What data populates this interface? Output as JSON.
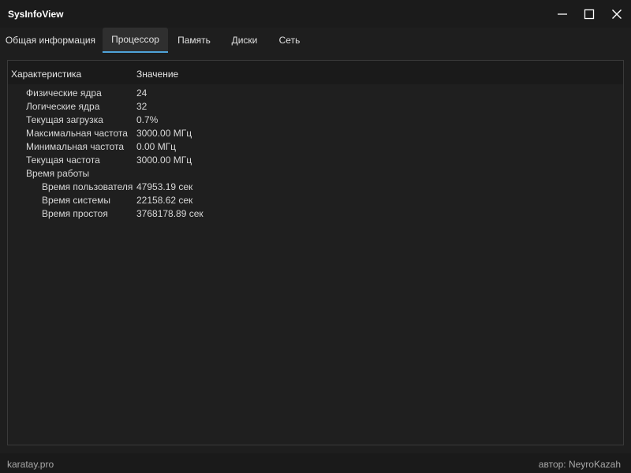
{
  "window": {
    "title": "SysInfoView",
    "controls": {
      "minimize_icon": "minimize-icon",
      "maximize_icon": "maximize-icon",
      "close_icon": "close-icon"
    }
  },
  "tabs": [
    {
      "label": "Общая информация",
      "active": false
    },
    {
      "label": "Процессор",
      "active": true
    },
    {
      "label": "Память",
      "active": false
    },
    {
      "label": "Диски",
      "active": false
    },
    {
      "label": "Сеть",
      "active": false
    }
  ],
  "tree": {
    "columns": {
      "key": "Характеристика",
      "value": "Значение"
    },
    "rows": [
      {
        "key": "Физические ядра",
        "value": "24"
      },
      {
        "key": "Логические ядра",
        "value": "32"
      },
      {
        "key": "Текущая загрузка",
        "value": "0.7%"
      },
      {
        "key": "Максимальная частота",
        "value": "3000.00 МГц"
      },
      {
        "key": "Минимальная частота",
        "value": "0.00 МГц"
      },
      {
        "key": "Текущая частота",
        "value": "3000.00 МГц"
      },
      {
        "key": "Время работы",
        "value": ""
      },
      {
        "key": "Время пользователя",
        "value": "47953.19 сек"
      },
      {
        "key": "Время системы",
        "value": "22158.62 сек"
      },
      {
        "key": "Время простоя",
        "value": "3768178.89 сек"
      }
    ]
  },
  "statusbar": {
    "left": "karatay.pro",
    "right": "автор: NeyroKazah"
  },
  "colors": {
    "background": "#1e1e1e",
    "active_tab_accent": "#4fa3d8",
    "text": "#dcdcdc"
  }
}
